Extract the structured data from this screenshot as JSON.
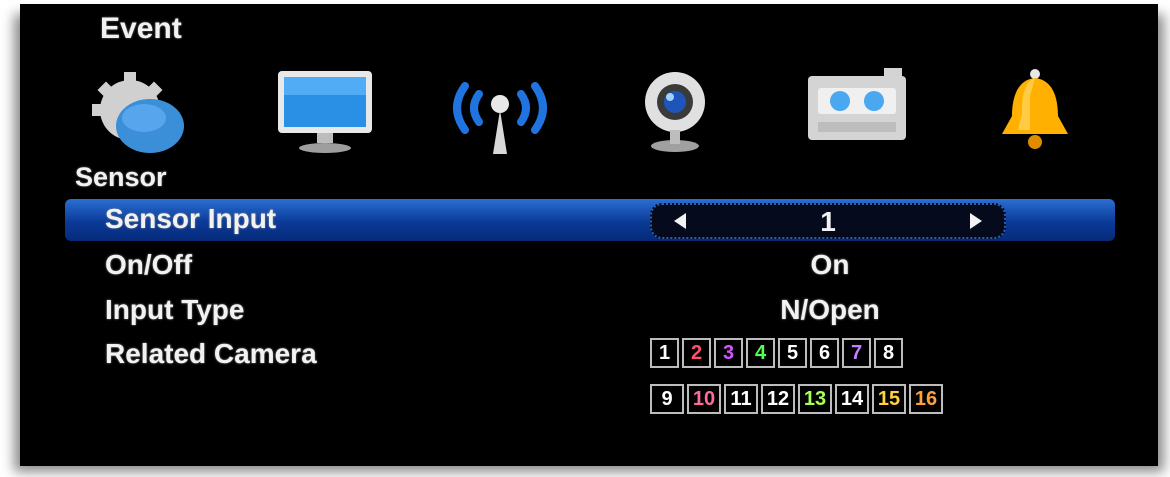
{
  "header": {
    "title": "Event"
  },
  "menu_icons": [
    {
      "name": "settings-gear-icon"
    },
    {
      "name": "monitor-display-icon"
    },
    {
      "name": "network-antenna-icon"
    },
    {
      "name": "webcam-camera-icon"
    },
    {
      "name": "recorder-device-icon"
    },
    {
      "name": "alarm-bell-icon"
    }
  ],
  "section": {
    "title": "Sensor"
  },
  "rows": {
    "sensor_input": {
      "label": "Sensor Input",
      "value": "1"
    },
    "on_off": {
      "label": "On/Off",
      "value": "On"
    },
    "input_type": {
      "label": "Input Type",
      "value": "N/Open"
    },
    "related_camera": {
      "label": "Related Camera"
    }
  },
  "cameras": {
    "row1": [
      {
        "label": "1",
        "color": "#ffffff"
      },
      {
        "label": "2",
        "color": "#ff4e6e"
      },
      {
        "label": "3",
        "color": "#d455ff"
      },
      {
        "label": "4",
        "color": "#55ff55"
      },
      {
        "label": "5",
        "color": "#ffffff"
      },
      {
        "label": "6",
        "color": "#ffffff"
      },
      {
        "label": "7",
        "color": "#c080ff"
      },
      {
        "label": "8",
        "color": "#ffffff"
      }
    ],
    "row2": [
      {
        "label": "9",
        "color": "#ffffff"
      },
      {
        "label": "10",
        "color": "#ff6aa0"
      },
      {
        "label": "11",
        "color": "#ffffff"
      },
      {
        "label": "12",
        "color": "#ffffff"
      },
      {
        "label": "13",
        "color": "#a8ff55"
      },
      {
        "label": "14",
        "color": "#ffffff"
      },
      {
        "label": "15",
        "color": "#ffd040"
      },
      {
        "label": "16",
        "color": "#ffa040"
      }
    ]
  },
  "colors": {
    "highlight": "#0a3a98",
    "background": "#000000",
    "text": "#f2f2f2"
  }
}
